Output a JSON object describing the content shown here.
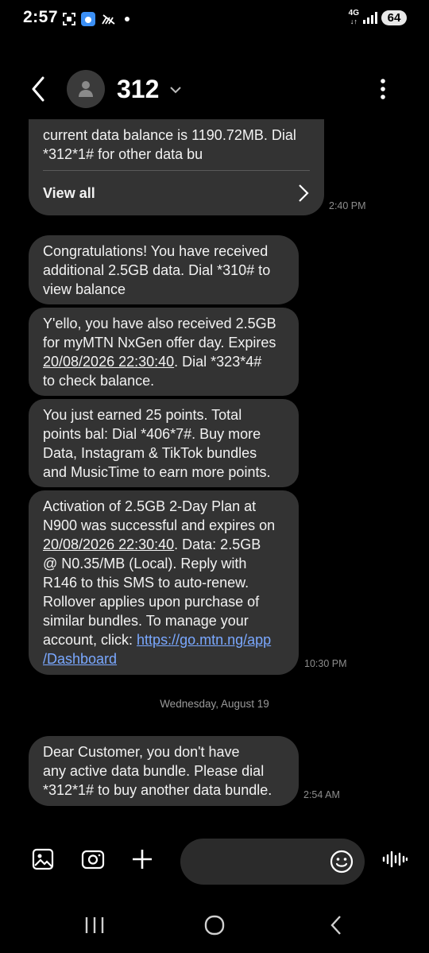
{
  "status_bar": {
    "time": "2:57",
    "network": "4G",
    "battery": "64"
  },
  "header": {
    "contact": "312"
  },
  "messages": {
    "m0": {
      "text": "current data balance is 1190.72MB. Dial\n*312*1# for other data bu",
      "view_all": "View all",
      "time": "2:40 PM"
    },
    "m1": {
      "text": "Congratulations! You have received\nadditional 2.5GB data. Dial *310# to\nview balance"
    },
    "m2": {
      "part1": "Y'ello, you have also received 2.5GB\nfor myMTN NxGen offer day. Expires\n",
      "date": "20/08/2026 22:30:40",
      "part2": ". Dial *323*4#\nto check balance."
    },
    "m3": {
      "text": "You just earned 25 points. Total\npoints bal: Dial *406*7#. Buy more\nData, Instagram & TikTok bundles\nand MusicTime to earn more points."
    },
    "m4": {
      "part1": "Activation of 2.5GB 2-Day Plan at\nN900 was successful and expires on\n",
      "date": "20/08/2026 22:30:40",
      "part2": ". Data: 2.5GB\n@ N0.35/MB (Local). Reply with\nR146 to this SMS to auto-renew.\nRollover applies upon purchase of\nsimilar bundles. To manage your\naccount, click: ",
      "link": "https://go.mtn.ng/app\n/Dashboard",
      "time": "10:30 PM"
    },
    "date_separator": "Wednesday, August 19",
    "m5": {
      "text": "Dear Customer, you don't have\nany active data bundle. Please dial\n*312*1# to buy another data bundle.",
      "time": "2:54 AM"
    }
  },
  "icons": {
    "status": [
      "screenshot-icon",
      "app-icon",
      "no-signal-icon",
      "dot-icon"
    ],
    "composer": [
      "gallery-icon",
      "camera-icon",
      "plus-icon",
      "emoji-icon",
      "voice-icon"
    ],
    "nav": [
      "recents-icon",
      "home-icon",
      "back-icon"
    ]
  }
}
